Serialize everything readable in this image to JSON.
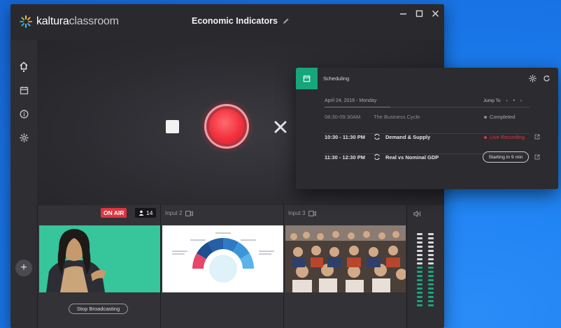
{
  "app": {
    "logo_bold": "kaltura",
    "logo_light": "classroom",
    "session_title": "Economic Indicators"
  },
  "window_controls": [
    "minimize-icon",
    "maximize-icon",
    "close-icon"
  ],
  "sidebar": {
    "items": [
      "home-icon",
      "calendar-icon",
      "info-icon",
      "settings-icon"
    ],
    "active": "home-icon"
  },
  "stage": {
    "controls": [
      "stop-button",
      "record-button",
      "close-button"
    ]
  },
  "inputs": [
    {
      "label": "",
      "on_air": "ON AIR",
      "viewers": "14",
      "action": "Stop Broadcasting"
    },
    {
      "label": "Input 2"
    },
    {
      "label": "Input 3"
    }
  ],
  "scheduling": {
    "title": "Scheduling",
    "date": "April 24, 2016 - Monday",
    "jump_to": "Jump To",
    "rows": [
      {
        "time": "08:30-09:30AM",
        "name": "The Business Cycle",
        "status": "Completed"
      },
      {
        "time": "10:30 - 11:30 PM",
        "name": "Demand & Supply",
        "status": "Live Recording"
      },
      {
        "time": "11:30 - 12:30 PM",
        "name": "Real vs Nominal GDP",
        "status": "Starting in 9 min"
      }
    ]
  },
  "colors": {
    "accent_green": "#17a57c",
    "live_red": "#e0353f",
    "background_blue": "#1b7ff0"
  }
}
